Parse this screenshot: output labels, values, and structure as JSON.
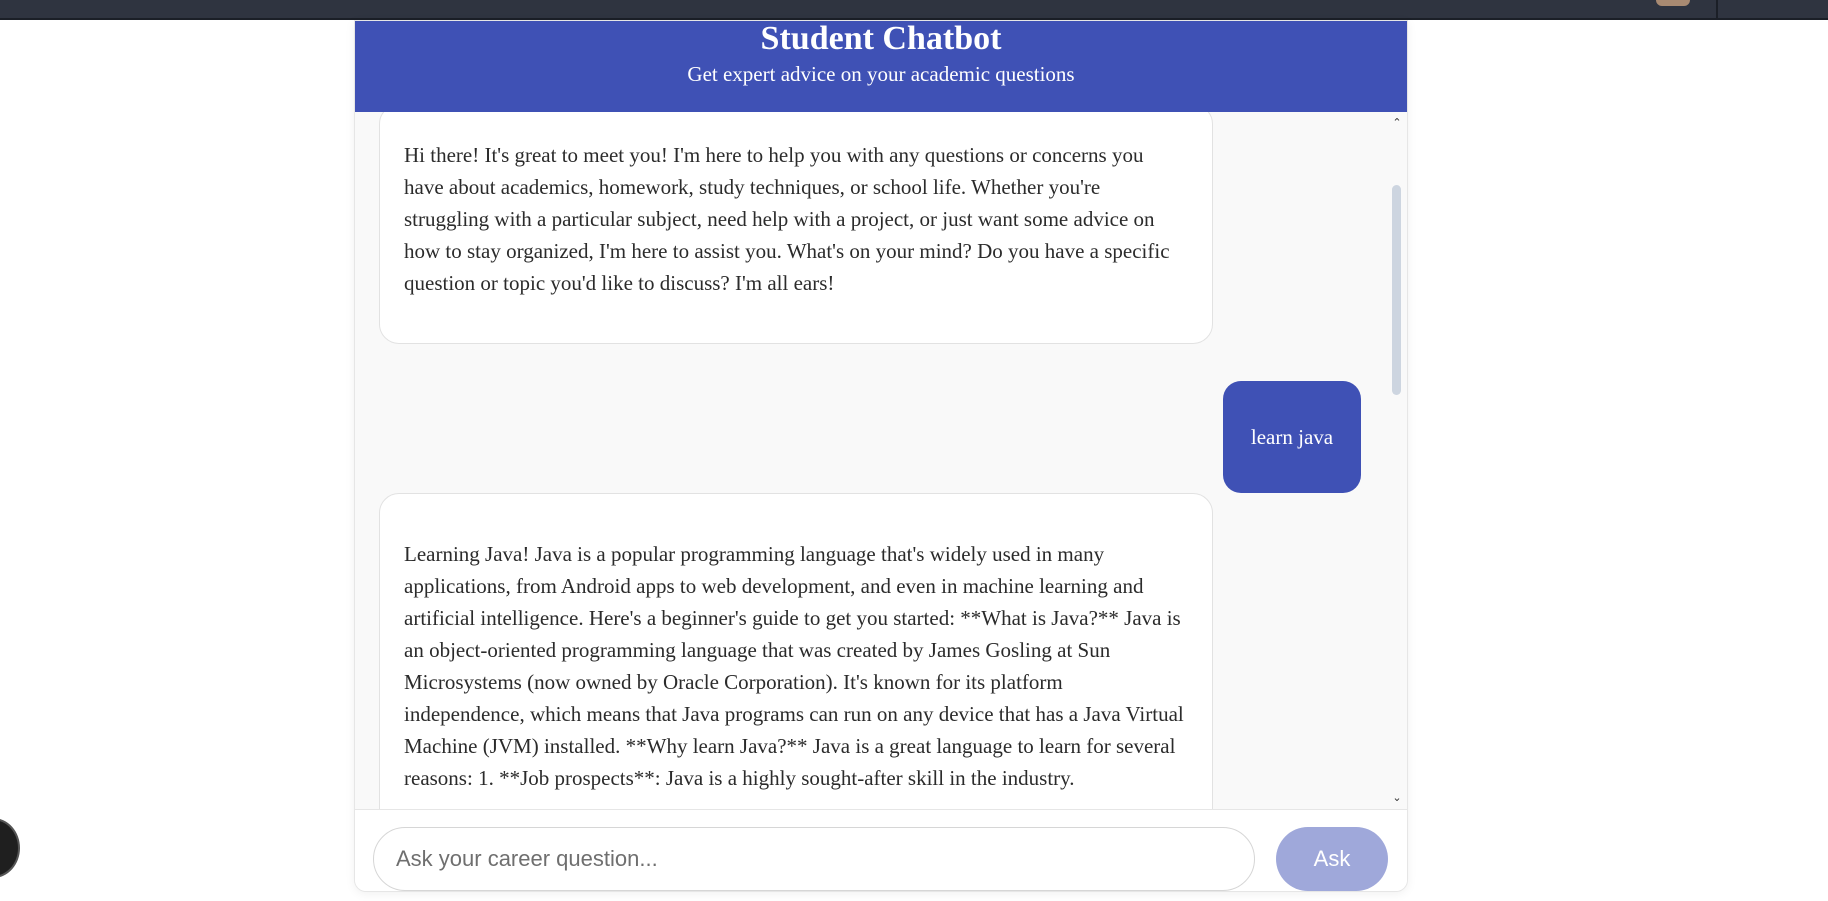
{
  "header": {
    "title": "Student Chatbot",
    "subtitle": "Get expert advice on your academic questions"
  },
  "messages": [
    {
      "role": "bot",
      "text": "Hi there! It's great to meet you! I'm here to help you with any questions or concerns you have about academics, homework, study techniques, or school life. Whether you're struggling with a particular subject, need help with a project, or just want some advice on how to stay organized, I'm here to assist you. What's on your mind? Do you have a specific question or topic you'd like to discuss? I'm all ears!"
    },
    {
      "role": "user",
      "text": "learn java"
    },
    {
      "role": "bot",
      "text": "Learning Java! Java is a popular programming language that's widely used in many applications, from Android apps to web development, and even in machine learning and artificial intelligence. Here's a beginner's guide to get you started: **What is Java?** Java is an object-oriented programming language that was created by James Gosling at Sun Microsystems (now owned by Oracle Corporation). It's known for its platform independence, which means that Java programs can run on any device that has a Java Virtual Machine (JVM) installed. **Why learn Java?** Java is a great language to learn for several reasons: 1. **Job prospects**: Java is a highly sought-after skill in the industry."
    }
  ],
  "input": {
    "placeholder": "Ask your career question...",
    "value": ""
  },
  "ask_button": {
    "label": "Ask"
  },
  "scrollbar": {
    "up_icon": "chevron-up-icon",
    "down_icon": "chevron-down-icon",
    "up_glyph": "⌃",
    "down_glyph": "⌄"
  },
  "colors": {
    "primary": "#3f51b5",
    "button_disabled": "#9fa8da",
    "chat_background": "#f9f9f9"
  }
}
